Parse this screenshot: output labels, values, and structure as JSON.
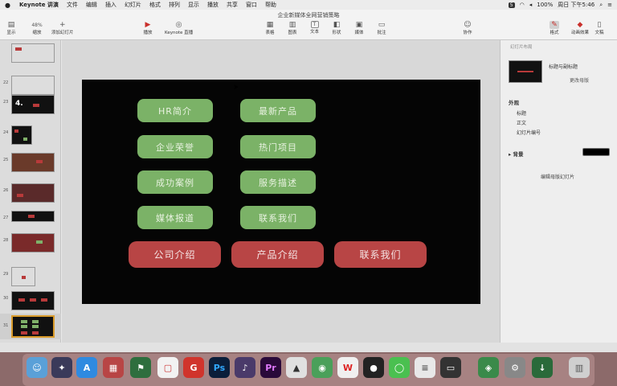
{
  "menubar": {
    "apple": "",
    "items": [
      "Keynote 讲演",
      "文件",
      "编辑",
      "插入",
      "幻灯片",
      "格式",
      "排列",
      "显示",
      "播放",
      "共享",
      "窗口",
      "帮助"
    ],
    "badge": "5",
    "battery": "100%",
    "clock": "周日 下午5:46"
  },
  "toolbar": {
    "doc_title": "企业新媒体全网营销策略",
    "view_label": "显示",
    "zoom_value": "48%",
    "zoom_label": "缩放",
    "add_slide_label": "添加幻灯片",
    "play_label": "播放",
    "live_label": "Keynote 直播",
    "table_label": "表格",
    "chart_label": "图表",
    "text_label": "文本",
    "shape_label": "形状",
    "media_label": "媒体",
    "comment_label": "批注",
    "collab_label": "协作",
    "format_label": "格式",
    "animate_label": "动画效果",
    "document_label": "文稿"
  },
  "navigator": {
    "slides": [
      "22",
      "23",
      "24",
      "25",
      "26",
      "27",
      "28",
      "29",
      "30",
      "31"
    ],
    "big_label": "4."
  },
  "slide": {
    "green_buttons": [
      "HR简介",
      "最新产品",
      "企业荣誉",
      "热门项目",
      "成功案例",
      "服务描述",
      "媒体报道",
      "联系我们"
    ],
    "red_buttons": [
      "公司介绍",
      "产品介绍",
      "联系我们"
    ]
  },
  "inspector": {
    "top_label": "幻灯片布局",
    "layout_name": "标题与副标题",
    "change_label": "更改母版",
    "appearance_title": "外观",
    "options": [
      "标题",
      "正文",
      "幻灯片编号"
    ],
    "background_label": "背景",
    "edit_master": "编辑母版幻灯片"
  },
  "colors": {
    "green_button": "#7bb267",
    "red_button": "#b84545",
    "slide_bg": "#050505"
  }
}
